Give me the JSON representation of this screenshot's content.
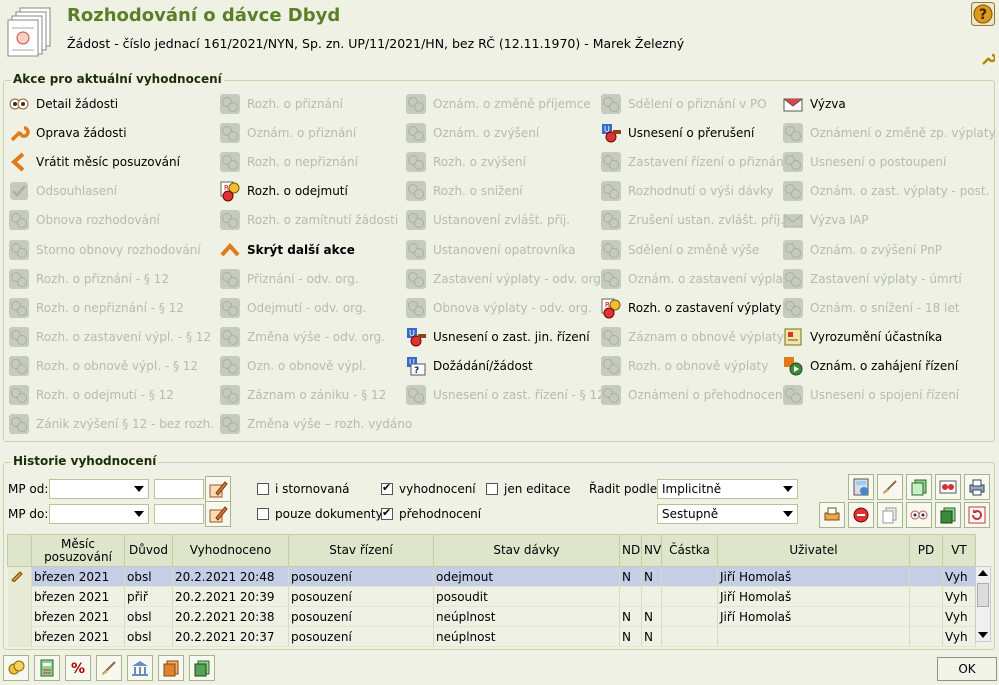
{
  "header": {
    "title": "Rozhodování o dávce Dbyd",
    "subtitle": "Žádost - číslo jednací 161/2021/NYN, Sp. zn. UP/11/2021/HN, bez RČ (12.11.1970) - Marek Železný"
  },
  "actions_group": {
    "title": "Akce pro aktuální vyhodnocení",
    "columns": [
      [
        {
          "label": "Detail žádosti",
          "enabled": true,
          "icon": "eyes-icon"
        },
        {
          "label": "Oprava žádosti",
          "enabled": true,
          "icon": "wrench-icon"
        },
        {
          "label": "Vrátit měsíc posuzování",
          "enabled": true,
          "icon": "back-arrow-icon"
        },
        {
          "label": "Odsouhlasení",
          "enabled": false,
          "icon": "check-icon"
        },
        {
          "label": "Obnova rozhodování",
          "enabled": false,
          "icon": "gear-icon"
        },
        {
          "label": "Storno obnovy rozhodování",
          "enabled": false,
          "icon": "gear-icon"
        },
        {
          "label": "Rozh. o přiznání - § 12",
          "enabled": false,
          "icon": "gears-icon"
        },
        {
          "label": "Rozh. o nepřiznání - § 12",
          "enabled": false,
          "icon": "gears-icon"
        },
        {
          "label": "Rozh. o zastavení výpl. - § 12",
          "enabled": false,
          "icon": "gears-icon"
        },
        {
          "label": "Rozh. o obnově výpl. - § 12",
          "enabled": false,
          "icon": "gears-icon"
        },
        {
          "label": "Rozh. o odejmutí - § 12",
          "enabled": false,
          "icon": "gears-icon"
        },
        {
          "label": "Zánik zvýšení § 12 - bez rozh.",
          "enabled": false,
          "icon": "gears-icon"
        }
      ],
      [
        {
          "label": "Rozh. o přiznání",
          "enabled": false,
          "icon": "gears-icon"
        },
        {
          "label": "Oznám. o přiznání",
          "enabled": false,
          "icon": "gears-icon"
        },
        {
          "label": "Rozh. o nepřiznání",
          "enabled": false,
          "icon": "gears-icon"
        },
        {
          "label": "Rozh. o odejmutí",
          "enabled": true,
          "bold": false,
          "icon": "document-stamp-icon"
        },
        {
          "label": "Rozh. o zamítnutí žádosti",
          "enabled": false,
          "icon": "gears-icon"
        },
        {
          "label": "Skrýt další akce",
          "enabled": true,
          "bold": true,
          "icon": "chevron-up-icon"
        },
        {
          "label": "Přiznání - odv. org.",
          "enabled": false,
          "icon": "gears-icon"
        },
        {
          "label": "Odejmutí - odv. org.",
          "enabled": false,
          "icon": "gears-icon"
        },
        {
          "label": "Změna výše - odv. org.",
          "enabled": false,
          "icon": "gears-icon"
        },
        {
          "label": "Ozn. o obnově výpl.",
          "enabled": false,
          "icon": "gears-icon"
        },
        {
          "label": "Záznam o zániku - § 12",
          "enabled": false,
          "icon": "gears-icon"
        },
        {
          "label": "Změna výše – rozh. vydáno",
          "enabled": false,
          "icon": "gears-icon"
        }
      ],
      [
        {
          "label": "Oznám. o změně příjemce",
          "enabled": false,
          "icon": "gears-icon"
        },
        {
          "label": "Oznám. o zvýšení",
          "enabled": false,
          "icon": "gears-icon"
        },
        {
          "label": "Rozh. o zvýšení",
          "enabled": false,
          "icon": "gears-icon"
        },
        {
          "label": "Rozh. o snížení",
          "enabled": false,
          "icon": "gears-icon"
        },
        {
          "label": "Ustanovení zvlášt. příj.",
          "enabled": false,
          "icon": "gears-icon"
        },
        {
          "label": "Ustanovení opatrovníka",
          "enabled": false,
          "icon": "gears-icon"
        },
        {
          "label": "Zastavení výplaty - odv. org.",
          "enabled": false,
          "icon": "gears-icon"
        },
        {
          "label": "Obnova výplaty - odv. org.",
          "enabled": false,
          "icon": "gears-icon"
        },
        {
          "label": "Usnesení o zast. jin. řízení",
          "enabled": true,
          "icon": "usneseni-icon"
        },
        {
          "label": "Dožádání/žádost",
          "enabled": true,
          "icon": "question-doc-icon"
        },
        {
          "label": "Usnesení o zast. řízení - § 12",
          "enabled": false,
          "icon": "gears-icon"
        }
      ],
      [
        {
          "label": "Sdělení o přiznání v PO",
          "enabled": false,
          "icon": "gears-icon"
        },
        {
          "label": "Usnesení o přerušení",
          "enabled": true,
          "icon": "usneseni-icon"
        },
        {
          "label": "Zastavení řízení o přiznání",
          "enabled": false,
          "icon": "gears-icon"
        },
        {
          "label": "Rozhodnutí o výši dávky",
          "enabled": false,
          "icon": "gears-icon"
        },
        {
          "label": "Zrušení ustan. zvlášt. příj.",
          "enabled": false,
          "icon": "gears-icon"
        },
        {
          "label": "Sdělení o změně výše",
          "enabled": false,
          "icon": "gears-icon"
        },
        {
          "label": "Oznám. o zastavení výplaty",
          "enabled": false,
          "icon": "gears-icon"
        },
        {
          "label": "Rozh. o zastavení výplaty",
          "enabled": true,
          "icon": "document-stamp-icon"
        },
        {
          "label": "Záznam o obnově výplaty",
          "enabled": false,
          "icon": "gears-icon"
        },
        {
          "label": "Rozh. o obnově výplaty",
          "enabled": false,
          "icon": "gears-icon"
        },
        {
          "label": "Oznámení o přehodnocení",
          "enabled": false,
          "icon": "gears-icon"
        }
      ],
      [
        {
          "label": "Výzva",
          "enabled": true,
          "icon": "envelope-icon"
        },
        {
          "label": "Oznámení o změně zp. výplaty",
          "enabled": false,
          "icon": "gears-icon"
        },
        {
          "label": "Usnesení o postoupení",
          "enabled": false,
          "icon": "gears-icon"
        },
        {
          "label": "Oznám. o zast. výplaty - post.",
          "enabled": false,
          "icon": "gears-icon"
        },
        {
          "label": "Výzva IAP",
          "enabled": false,
          "icon": "envelope-icon"
        },
        {
          "label": "Oznám. o zvýšení PnP",
          "enabled": false,
          "icon": "gears-icon"
        },
        {
          "label": "Zastavení výplaty - úmrtí",
          "enabled": false,
          "icon": "gears-icon"
        },
        {
          "label": "Oznám. o snížení - 18 let",
          "enabled": false,
          "icon": "gears-icon"
        },
        {
          "label": "Vyrozumění účastníka",
          "enabled": true,
          "icon": "notice-icon"
        },
        {
          "label": "Oznám. o zahájení řízení",
          "enabled": true,
          "icon": "start-proceeding-icon"
        },
        {
          "label": "Usnesení o spojení řízení",
          "enabled": false,
          "icon": "gears-icon"
        }
      ]
    ]
  },
  "history": {
    "title": "Historie vyhodnocení",
    "mp_od_label": "MP od:",
    "mp_do_label": "MP do:",
    "chk_stornovana": "i stornovaná",
    "chk_pouze_dokumenty": "pouze dokumenty",
    "chk_vyhodnoceni": "vyhodnocení",
    "chk_prehodnoceni": "přehodnocení",
    "chk_jen_editace": "jen editace",
    "sort_label": "Řadit podle:",
    "sort_value": "Implicitně",
    "order_value": "Sestupně",
    "columns": [
      "",
      "Měsíc posuzování",
      "Důvod",
      "Vyhodnoceno",
      "Stav řízení",
      "Stav dávky",
      "ND",
      "NV",
      "Částka",
      "Uživatel",
      "PD",
      "VT"
    ],
    "rows": [
      {
        "mesic": "březen 2021",
        "duvod": "obsl",
        "vyhodnoceno": "20.2.2021 20:48",
        "stav_rizeni": "posouzení",
        "stav_davky": "odejmout",
        "nd": "N",
        "nv": "N",
        "castka": "",
        "uzivatel": "Jiří Homolaš",
        "pd": "",
        "vt": "Vyh",
        "selected": true
      },
      {
        "mesic": "březen 2021",
        "duvod": "přiř",
        "vyhodnoceno": "20.2.2021 20:39",
        "stav_rizeni": "posouzení",
        "stav_davky": "posoudit",
        "nd": "",
        "nv": "",
        "castka": "",
        "uzivatel": "Jiří Homolaš",
        "pd": "",
        "vt": "Vyh",
        "selected": false
      },
      {
        "mesic": "březen 2021",
        "duvod": "obsl",
        "vyhodnoceno": "20.2.2021 20:38",
        "stav_rizeni": "posouzení",
        "stav_davky": "neúplnost",
        "nd": "N",
        "nv": "N",
        "castka": "",
        "uzivatel": "Jiří Homolaš",
        "pd": "",
        "vt": "Vyh",
        "selected": false
      },
      {
        "mesic": "březen 2021",
        "duvod": "obsl",
        "vyhodnoceno": "20.2.2021 20:37",
        "stav_rizeni": "posouzení",
        "stav_davky": "neúplnost",
        "nd": "N",
        "nv": "N",
        "castka": "",
        "uzivatel": "",
        "pd": "",
        "vt": "Vyh",
        "selected": false
      }
    ]
  },
  "footer": {
    "ok_label": "OK"
  },
  "colors": {
    "title": "#5a7f27",
    "background": "#eef1e3",
    "enabled_text": "#000000",
    "disabled_text": "#b5bcae",
    "selected_row": "#c6cde6"
  }
}
